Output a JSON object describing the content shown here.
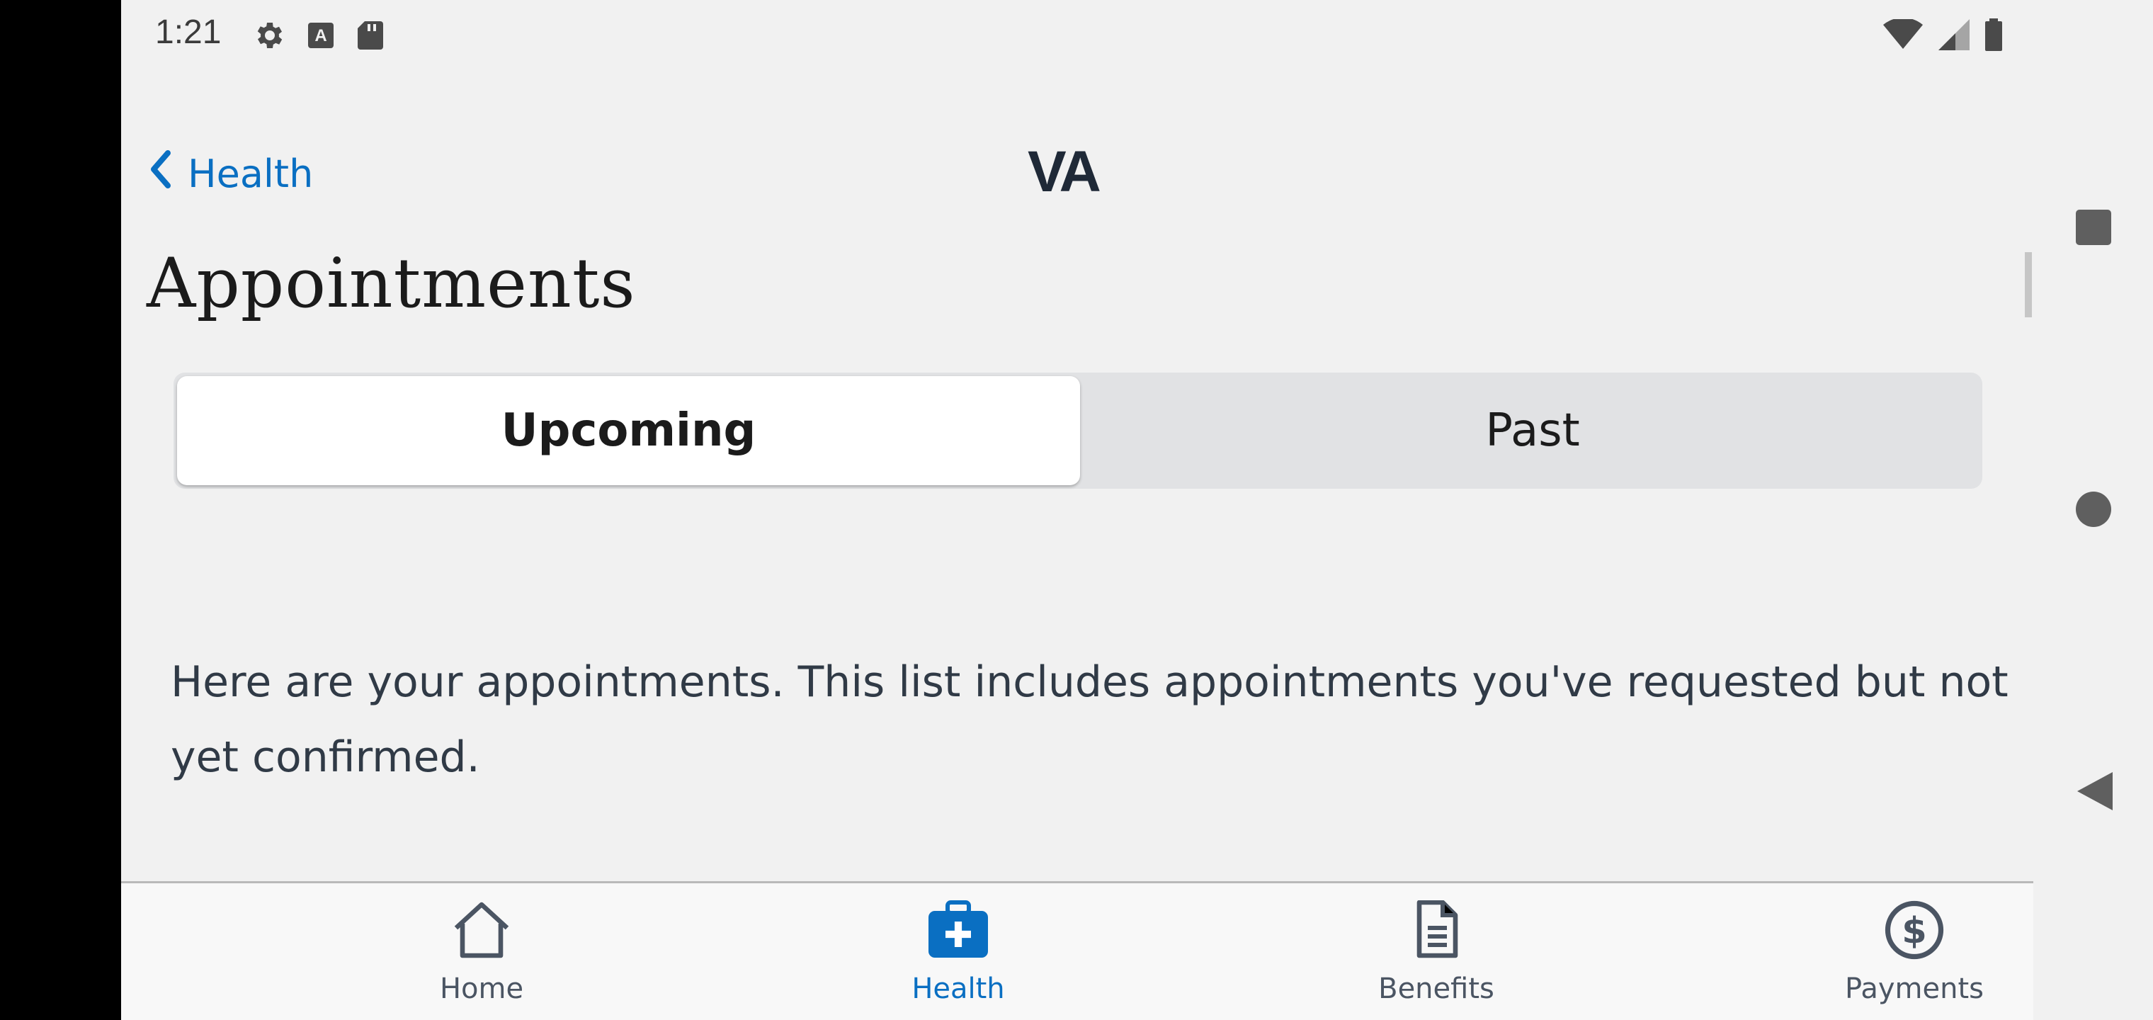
{
  "status_bar": {
    "time": "1:21",
    "icons": [
      "settings-icon",
      "accessibility-a-icon",
      "sd-card-icon",
      "wifi-icon",
      "cellular-signal-icon",
      "battery-icon"
    ]
  },
  "header": {
    "back_label": "Health",
    "logo_text": "VA"
  },
  "page": {
    "title": "Appointments",
    "segmented": {
      "upcoming_label": "Upcoming",
      "past_label": "Past",
      "selected": "Upcoming"
    },
    "intro_text": "Here are your appointments. This list includes appointments you've requested but not yet confirmed."
  },
  "tab_bar": {
    "items": [
      {
        "label": "Home",
        "icon": "home-icon"
      },
      {
        "label": "Health",
        "icon": "medical-kit-icon",
        "active": true
      },
      {
        "label": "Benefits",
        "icon": "document-icon"
      },
      {
        "label": "Payments",
        "icon": "dollar-circle-icon"
      }
    ]
  },
  "nav_buttons": [
    "recents-square-icon",
    "home-circle-icon",
    "back-triangle-icon"
  ],
  "colors": {
    "accent": "#0a6fc2",
    "background": "#f1f1f1",
    "segment_track": "#e1e2e4",
    "text_dark": "#1b1b1b",
    "icon_gray": "#4b5563"
  }
}
